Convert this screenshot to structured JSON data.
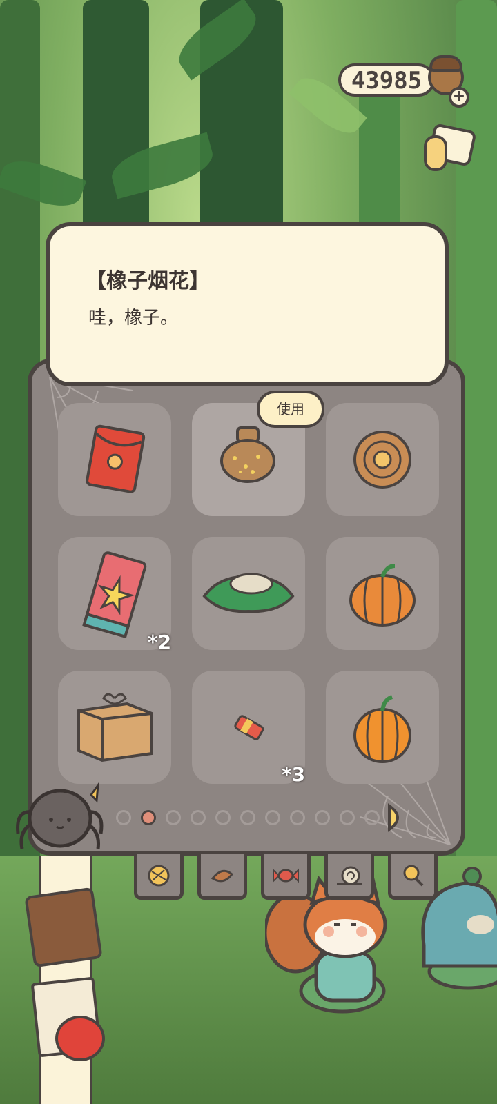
{
  "currency": {
    "amount": "43985",
    "icon": "acorn-icon"
  },
  "dialog": {
    "title": "【橡子烟花】",
    "body": "哇，橡子。"
  },
  "inventory": {
    "use_label": "使用",
    "items": [
      {
        "name": "red-envelope",
        "qty": ""
      },
      {
        "name": "acorn-firework-jar",
        "qty": ""
      },
      {
        "name": "spiral-cookie",
        "qty": ""
      },
      {
        "name": "firework-card",
        "qty": "*2"
      },
      {
        "name": "green-wrap-bundle",
        "qty": ""
      },
      {
        "name": "pumpkin-small",
        "qty": ""
      },
      {
        "name": "cardboard-box",
        "qty": ""
      },
      {
        "name": "firecracker",
        "qty": "*3"
      },
      {
        "name": "pumpkin-orange",
        "qty": ""
      }
    ],
    "page_count": 11,
    "current_page": 2
  },
  "tabs": [
    "yarn-ball-icon",
    "leaf-icon",
    "candy-icon",
    "snail-icon",
    "magnifier-icon"
  ],
  "colors": {
    "panel": "#8d8582",
    "slot": "#9f9794",
    "outline": "#4a4340",
    "dialog": "#fdf6df"
  }
}
